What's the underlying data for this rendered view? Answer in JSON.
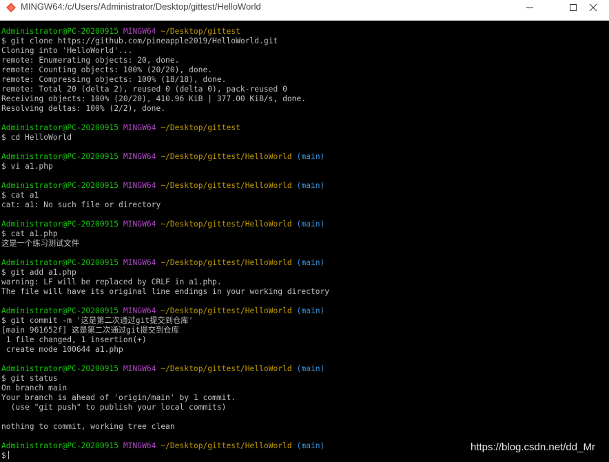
{
  "window": {
    "title": "MINGW64:/c/Users/Administrator/Desktop/gittest/HelloWorld"
  },
  "terminal": {
    "p1": {
      "user": "Administrator@PC-20200915",
      "shell": "MINGW64",
      "path": "~/Desktop/gittest",
      "branch": ""
    },
    "c1": "$ git clone https://github.com/pineapple2019/HelloWorld.git",
    "o1": "Cloning into 'HelloWorld'...",
    "o2": "remote: Enumerating objects: 20, done.",
    "o3": "remote: Counting objects: 100% (20/20), done.",
    "o4": "remote: Compressing objects: 100% (18/18), done.",
    "o5": "remote: Total 20 (delta 2), reused 0 (delta 0), pack-reused 0",
    "o6": "Receiving objects: 100% (20/20), 410.96 KiB | 377.00 KiB/s, done.",
    "o7": "Resolving deltas: 100% (2/2), done.",
    "p2": {
      "user": "Administrator@PC-20200915",
      "shell": "MINGW64",
      "path": "~/Desktop/gittest",
      "branch": ""
    },
    "c2": "$ cd HelloWorld",
    "p3": {
      "user": "Administrator@PC-20200915",
      "shell": "MINGW64",
      "path": "~/Desktop/gittest/HelloWorld",
      "branch": "(main)"
    },
    "c3": "$ vi a1.php",
    "p4": {
      "user": "Administrator@PC-20200915",
      "shell": "MINGW64",
      "path": "~/Desktop/gittest/HelloWorld",
      "branch": "(main)"
    },
    "c4": "$ cat a1",
    "o8": "cat: a1: No such file or directory",
    "p5": {
      "user": "Administrator@PC-20200915",
      "shell": "MINGW64",
      "path": "~/Desktop/gittest/HelloWorld",
      "branch": "(main)"
    },
    "c5": "$ cat a1.php",
    "o9": "这是一个练习测试文件",
    "p6": {
      "user": "Administrator@PC-20200915",
      "shell": "MINGW64",
      "path": "~/Desktop/gittest/HelloWorld",
      "branch": "(main)"
    },
    "c6": "$ git add a1.php",
    "o10": "warning: LF will be replaced by CRLF in a1.php.",
    "o11": "The file will have its original line endings in your working directory",
    "p7": {
      "user": "Administrator@PC-20200915",
      "shell": "MINGW64",
      "path": "~/Desktop/gittest/HelloWorld",
      "branch": "(main)"
    },
    "c7": "$ git commit -m '这是第二次通过git提交到仓库'",
    "o12": "[main 961652f] 这是第二次通过git提交到仓库",
    "o13": " 1 file changed, 1 insertion(+)",
    "o14": " create mode 100644 a1.php",
    "p8": {
      "user": "Administrator@PC-20200915",
      "shell": "MINGW64",
      "path": "~/Desktop/gittest/HelloWorld",
      "branch": "(main)"
    },
    "c8": "$ git status",
    "o15": "On branch main",
    "o16": "Your branch is ahead of 'origin/main' by 1 commit.",
    "o17": "  (use \"git push\" to publish your local commits)",
    "o18": "nothing to commit, working tree clean",
    "p9": {
      "user": "Administrator@PC-20200915",
      "shell": "MINGW64",
      "path": "~/Desktop/gittest/HelloWorld",
      "branch": "(main)"
    },
    "c9": "$"
  },
  "watermark": "https://blog.csdn.net/dd_Mr",
  "colors": {
    "user": "#16c60c",
    "shell": "#b148c6",
    "path": "#c19c00",
    "branch": "#3a96dd",
    "text": "#c0c0c0",
    "background": "#000000"
  }
}
